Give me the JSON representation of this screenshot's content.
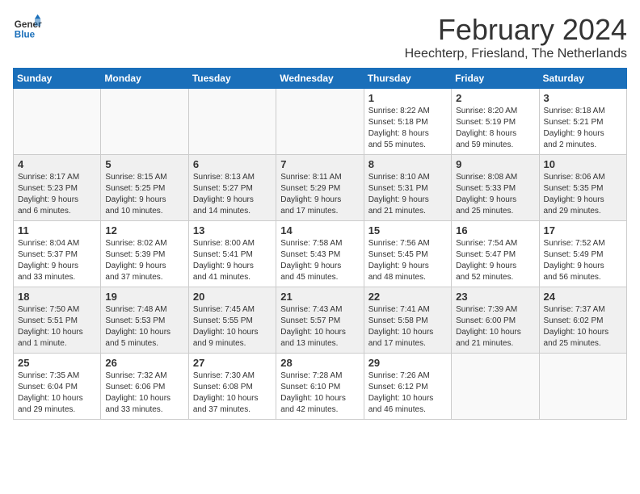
{
  "header": {
    "logo_line1": "General",
    "logo_line2": "Blue",
    "month_title": "February 2024",
    "subtitle": "Heechterp, Friesland, The Netherlands"
  },
  "days_of_week": [
    "Sunday",
    "Monday",
    "Tuesday",
    "Wednesday",
    "Thursday",
    "Friday",
    "Saturday"
  ],
  "weeks": [
    [
      {
        "day": "",
        "info": ""
      },
      {
        "day": "",
        "info": ""
      },
      {
        "day": "",
        "info": ""
      },
      {
        "day": "",
        "info": ""
      },
      {
        "day": "1",
        "info": "Sunrise: 8:22 AM\nSunset: 5:18 PM\nDaylight: 8 hours\nand 55 minutes."
      },
      {
        "day": "2",
        "info": "Sunrise: 8:20 AM\nSunset: 5:19 PM\nDaylight: 8 hours\nand 59 minutes."
      },
      {
        "day": "3",
        "info": "Sunrise: 8:18 AM\nSunset: 5:21 PM\nDaylight: 9 hours\nand 2 minutes."
      }
    ],
    [
      {
        "day": "4",
        "info": "Sunrise: 8:17 AM\nSunset: 5:23 PM\nDaylight: 9 hours\nand 6 minutes."
      },
      {
        "day": "5",
        "info": "Sunrise: 8:15 AM\nSunset: 5:25 PM\nDaylight: 9 hours\nand 10 minutes."
      },
      {
        "day": "6",
        "info": "Sunrise: 8:13 AM\nSunset: 5:27 PM\nDaylight: 9 hours\nand 14 minutes."
      },
      {
        "day": "7",
        "info": "Sunrise: 8:11 AM\nSunset: 5:29 PM\nDaylight: 9 hours\nand 17 minutes."
      },
      {
        "day": "8",
        "info": "Sunrise: 8:10 AM\nSunset: 5:31 PM\nDaylight: 9 hours\nand 21 minutes."
      },
      {
        "day": "9",
        "info": "Sunrise: 8:08 AM\nSunset: 5:33 PM\nDaylight: 9 hours\nand 25 minutes."
      },
      {
        "day": "10",
        "info": "Sunrise: 8:06 AM\nSunset: 5:35 PM\nDaylight: 9 hours\nand 29 minutes."
      }
    ],
    [
      {
        "day": "11",
        "info": "Sunrise: 8:04 AM\nSunset: 5:37 PM\nDaylight: 9 hours\nand 33 minutes."
      },
      {
        "day": "12",
        "info": "Sunrise: 8:02 AM\nSunset: 5:39 PM\nDaylight: 9 hours\nand 37 minutes."
      },
      {
        "day": "13",
        "info": "Sunrise: 8:00 AM\nSunset: 5:41 PM\nDaylight: 9 hours\nand 41 minutes."
      },
      {
        "day": "14",
        "info": "Sunrise: 7:58 AM\nSunset: 5:43 PM\nDaylight: 9 hours\nand 45 minutes."
      },
      {
        "day": "15",
        "info": "Sunrise: 7:56 AM\nSunset: 5:45 PM\nDaylight: 9 hours\nand 48 minutes."
      },
      {
        "day": "16",
        "info": "Sunrise: 7:54 AM\nSunset: 5:47 PM\nDaylight: 9 hours\nand 52 minutes."
      },
      {
        "day": "17",
        "info": "Sunrise: 7:52 AM\nSunset: 5:49 PM\nDaylight: 9 hours\nand 56 minutes."
      }
    ],
    [
      {
        "day": "18",
        "info": "Sunrise: 7:50 AM\nSunset: 5:51 PM\nDaylight: 10 hours\nand 1 minute."
      },
      {
        "day": "19",
        "info": "Sunrise: 7:48 AM\nSunset: 5:53 PM\nDaylight: 10 hours\nand 5 minutes."
      },
      {
        "day": "20",
        "info": "Sunrise: 7:45 AM\nSunset: 5:55 PM\nDaylight: 10 hours\nand 9 minutes."
      },
      {
        "day": "21",
        "info": "Sunrise: 7:43 AM\nSunset: 5:57 PM\nDaylight: 10 hours\nand 13 minutes."
      },
      {
        "day": "22",
        "info": "Sunrise: 7:41 AM\nSunset: 5:58 PM\nDaylight: 10 hours\nand 17 minutes."
      },
      {
        "day": "23",
        "info": "Sunrise: 7:39 AM\nSunset: 6:00 PM\nDaylight: 10 hours\nand 21 minutes."
      },
      {
        "day": "24",
        "info": "Sunrise: 7:37 AM\nSunset: 6:02 PM\nDaylight: 10 hours\nand 25 minutes."
      }
    ],
    [
      {
        "day": "25",
        "info": "Sunrise: 7:35 AM\nSunset: 6:04 PM\nDaylight: 10 hours\nand 29 minutes."
      },
      {
        "day": "26",
        "info": "Sunrise: 7:32 AM\nSunset: 6:06 PM\nDaylight: 10 hours\nand 33 minutes."
      },
      {
        "day": "27",
        "info": "Sunrise: 7:30 AM\nSunset: 6:08 PM\nDaylight: 10 hours\nand 37 minutes."
      },
      {
        "day": "28",
        "info": "Sunrise: 7:28 AM\nSunset: 6:10 PM\nDaylight: 10 hours\nand 42 minutes."
      },
      {
        "day": "29",
        "info": "Sunrise: 7:26 AM\nSunset: 6:12 PM\nDaylight: 10 hours\nand 46 minutes."
      },
      {
        "day": "",
        "info": ""
      },
      {
        "day": "",
        "info": ""
      }
    ]
  ]
}
